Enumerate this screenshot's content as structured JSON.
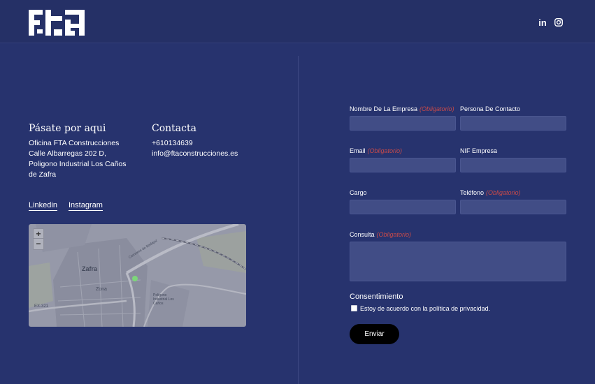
{
  "header": {
    "logo_text": "FTA",
    "social": [
      {
        "name": "linkedin",
        "label": "in"
      },
      {
        "name": "instagram",
        "label": ""
      }
    ]
  },
  "visit": {
    "title": "Pásate por aqui",
    "lines": [
      "Oficina FTA Construcciones",
      "Calle Albarregas 202 D,",
      "Poligono Industrial Los Caños",
      "de Zafra"
    ]
  },
  "contact": {
    "title": "Contacta",
    "phone": "+610134639",
    "email": "info@ftaconstrucciones.es"
  },
  "links": {
    "linkedin": "Linkedin",
    "instagram": "Instagram"
  },
  "map": {
    "zoom_in": "+",
    "zoom_out": "−",
    "labels": {
      "city": "Zafra",
      "road": "EX-321",
      "zone": "Zona",
      "industrial": "Poligono Industrial Los Caños",
      "highway": "Carretera de Badajoz"
    }
  },
  "form": {
    "required_text": "(Obligatorio)",
    "fields": {
      "company": {
        "label": "Nombre De La Empresa",
        "value": ""
      },
      "contact_person": {
        "label": "Persona De Contacto",
        "value": ""
      },
      "email": {
        "label": "Email",
        "value": ""
      },
      "nif": {
        "label": "NIF Empresa",
        "value": ""
      },
      "role": {
        "label": "Cargo",
        "value": ""
      },
      "phone": {
        "label": "Teléfono",
        "value": ""
      },
      "query": {
        "label": "Consulta",
        "value": ""
      }
    },
    "consent_title": "Consentimiento",
    "consent_text": "Estoy de acuerdo con la política de privacidad.",
    "consent_checked": false,
    "submit_label": "Enviar"
  },
  "colors": {
    "background": "#27336e",
    "header": "#253066",
    "input": "#414d86",
    "required": "#c74a4a",
    "button": "#000000",
    "map_marker": "#7dd67a"
  }
}
